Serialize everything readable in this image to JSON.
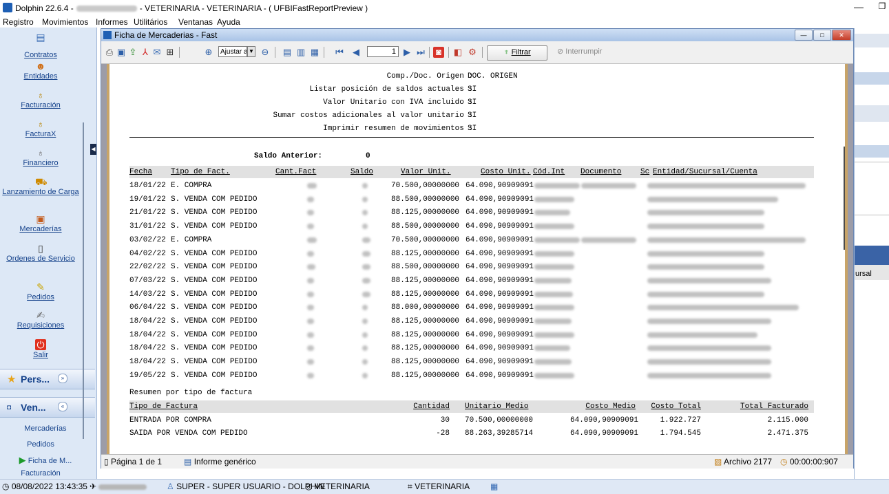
{
  "app": {
    "title_prefix": "Dolphin 22.6.4 -",
    "title_suffix": "- VETERINARIA - VETERINARIA - ( UFBIFastReportPreview )",
    "min_glyph": "—",
    "max_glyph": "❐"
  },
  "menu": [
    "Registro",
    "Movimientos",
    "Informes",
    "Utilitários",
    "Ventanas",
    "Ayuda"
  ],
  "sidebar": {
    "items": [
      {
        "label": "Contratos",
        "icon": "contracts-icon"
      },
      {
        "label": "Entidades",
        "icon": "people-icon"
      },
      {
        "label": "Facturación",
        "icon": "money-bag-icon"
      },
      {
        "label": "FacturaX",
        "icon": "money-bag-icon"
      },
      {
        "label": "Financiero",
        "icon": "money-bag-icon"
      },
      {
        "label": "Lanzamiento de Carga",
        "icon": "truck-icon"
      },
      {
        "label": "Mercaderías",
        "icon": "box-icon"
      },
      {
        "label": "Ordenes de Servicio",
        "icon": "clipboard-icon"
      },
      {
        "label": "Pedidos",
        "icon": "cart-icon"
      },
      {
        "label": "Requisiciones",
        "icon": "pen-icon"
      },
      {
        "label": "Salir",
        "icon": "exit-icon"
      }
    ],
    "panes": [
      {
        "label": "Pers...",
        "chevron": "»"
      },
      {
        "label": "Ven...",
        "chevron": "«"
      }
    ],
    "ven_links": [
      "Mercaderías",
      "Pedidos",
      "Ficha de M...",
      "Facturación"
    ]
  },
  "child": {
    "title": "Ficha de Mercaderias - Fast",
    "zoom": "Ajustar a",
    "page": "1",
    "filter_label": "Filtrar",
    "interrupt_label": "Interrumpir",
    "status_page": "Página 1 de 1",
    "status_report": "Informe genérico",
    "status_file": "Archivo 2177",
    "status_time": "00:00:00:907"
  },
  "report": {
    "params": [
      {
        "label": "Comp./Doc. Origen :",
        "value": "DOC. ORIGEN"
      },
      {
        "label": "Listar posición de saldos actuales :",
        "value": "SI"
      },
      {
        "label": "Valor Unitario con IVA incluido :",
        "value": "SI"
      },
      {
        "label": "Sumar costos adicionales al valor unitario :",
        "value": "SI"
      },
      {
        "label": "Imprimir resumen de movimientos :",
        "value": "SI"
      }
    ],
    "previous_balance_label": "Saldo Anterior:",
    "previous_balance_value": "0",
    "columns": {
      "fecha": "Fecha",
      "tipo": "Tipo de Fact.",
      "cant": "Cant.Fact",
      "saldo": "Saldo",
      "valor": "Valor Unit.",
      "costo": "Costo Unit.",
      "codint": "Cód.Int",
      "documento": "Documento",
      "sc": "Sc",
      "entidad": "Entidad/Sucursal/Cuenta"
    },
    "rows": [
      {
        "fecha": "18/01/22",
        "tipo": "E. COMPRA",
        "valor": "70.500,00000000",
        "costo": "64.090,90909091",
        "doc": true
      },
      {
        "fecha": "19/01/22",
        "tipo": "S. VENDA COM PEDIDO",
        "valor": "88.500,00000000",
        "costo": "64.090,90909091",
        "doc": false
      },
      {
        "fecha": "21/01/22",
        "tipo": "S. VENDA COM PEDIDO",
        "valor": "88.125,00000000",
        "costo": "64.090,90909091",
        "doc": false
      },
      {
        "fecha": "31/01/22",
        "tipo": "S. VENDA COM PEDIDO",
        "valor": "88.500,00000000",
        "costo": "64.090,90909091",
        "doc": false
      },
      {
        "fecha": "03/02/22",
        "tipo": "E. COMPRA",
        "valor": "70.500,00000000",
        "costo": "64.090,90909091",
        "doc": true
      },
      {
        "fecha": "04/02/22",
        "tipo": "S. VENDA COM PEDIDO",
        "valor": "88.125,00000000",
        "costo": "64.090,90909091",
        "doc": false
      },
      {
        "fecha": "22/02/22",
        "tipo": "S. VENDA COM PEDIDO",
        "valor": "88.500,00000000",
        "costo": "64.090,90909091",
        "doc": false
      },
      {
        "fecha": "07/03/22",
        "tipo": "S. VENDA COM PEDIDO",
        "valor": "88.125,00000000",
        "costo": "64.090,90909091",
        "doc": false
      },
      {
        "fecha": "14/03/22",
        "tipo": "S. VENDA COM PEDIDO",
        "valor": "88.125,00000000",
        "costo": "64.090,90909091",
        "doc": false
      },
      {
        "fecha": "06/04/22",
        "tipo": "S. VENDA COM PEDIDO",
        "valor": "88.000,00000000",
        "costo": "64.090,90909091",
        "doc": false
      },
      {
        "fecha": "18/04/22",
        "tipo": "S. VENDA COM PEDIDO",
        "valor": "88.125,00000000",
        "costo": "64.090,90909091",
        "doc": false
      },
      {
        "fecha": "18/04/22",
        "tipo": "S. VENDA COM PEDIDO",
        "valor": "88.125,00000000",
        "costo": "64.090,90909091",
        "doc": false
      },
      {
        "fecha": "18/04/22",
        "tipo": "S. VENDA COM PEDIDO",
        "valor": "88.125,00000000",
        "costo": "64.090,90909091",
        "doc": false
      },
      {
        "fecha": "18/04/22",
        "tipo": "S. VENDA COM PEDIDO",
        "valor": "88.125,00000000",
        "costo": "64.090,90909091",
        "doc": false
      },
      {
        "fecha": "19/05/22",
        "tipo": "S. VENDA COM PEDIDO",
        "valor": "88.125,00000000",
        "costo": "64.090,90909091",
        "doc": false
      }
    ],
    "summary_title": "Resumen por tipo de factura",
    "summary_columns": {
      "tipo": "Tipo de Factura",
      "cantidad": "Cantidad",
      "unitario": "Unitario Medio",
      "costo_medio": "Costo Medio",
      "costo_total": "Costo Total",
      "total_facturado": "Total Facturado"
    },
    "summary_rows": [
      {
        "tipo": "ENTRADA POR COMPRA",
        "cantidad": "30",
        "unitario": "70.500,00000000",
        "costo_medio": "64.090,90909091",
        "costo_total": "1.922.727",
        "total_facturado": "2.115.000"
      },
      {
        "tipo": "SAIDA POR VENDA COM PEDIDO",
        "cantidad": "-28",
        "unitario": "88.263,39285714",
        "costo_medio": "64.090,90909091",
        "costo_total": "1.794.545",
        "total_facturado": "2.471.375"
      }
    ]
  },
  "right_panel": {
    "label": "ursal"
  },
  "statusbar": {
    "datetime": "08/08/2022 13:43:35",
    "user": "SUPER - SUPER USUARIO - DOLPHIN",
    "location": "VETERINARIA",
    "company": "VETERINARIA"
  },
  "colors": {
    "accent": "#15428b",
    "sidebar_bg": "#dde8f6",
    "report_header_band": "#e1e1e1"
  }
}
